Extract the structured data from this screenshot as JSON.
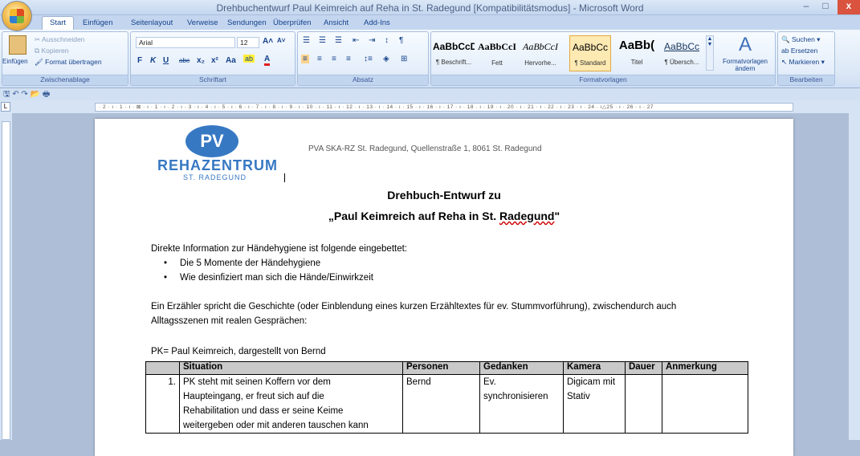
{
  "window": {
    "title": "Drehbuchentwurf Paul Keimreich auf Reha in St. Radegund [Kompatibilitätsmodus] - Microsoft Word",
    "close": "x"
  },
  "tabs": [
    "Start",
    "Einfügen",
    "Seitenlayout",
    "Verweise",
    "Sendungen",
    "Überprüfen",
    "Ansicht",
    "Add-Ins"
  ],
  "clipboard": {
    "paste": "Einfügen",
    "cut": "Ausschneiden",
    "copy": "Kopieren",
    "format_painter": "Format übertragen",
    "label": "Zwischenablage"
  },
  "font": {
    "family": "Arial",
    "size": "12",
    "bold": "F",
    "italic": "K",
    "underline": "U",
    "strike": "abe",
    "sub": "x₂",
    "sup": "x²",
    "case": "Aa",
    "label": "Schriftart"
  },
  "paragraph": {
    "label": "Absatz"
  },
  "styles": {
    "items": [
      {
        "preview": "AaBbCcD",
        "name": "¶ Beschrift..."
      },
      {
        "preview": "AaBbCcI",
        "name": "Fett"
      },
      {
        "preview": "AaBbCcI",
        "name": "Hervorhe..."
      },
      {
        "preview": "AaBbCc",
        "name": "¶ Standard"
      },
      {
        "preview": "AaBb(",
        "name": "Titel"
      },
      {
        "preview": "AaBbCc",
        "name": "¶ Übersch..."
      }
    ],
    "change": "Formatvorlagen ändern",
    "label": "Formatvorlagen"
  },
  "editing": {
    "find": "Suchen",
    "replace": "Ersetzen",
    "select": "Markieren",
    "label": "Bearbeiten"
  },
  "ruler": "· 2 · ı · 1 · ı · ⊠ · ı · 1 · ı · 2 · ı · 3 · ı · 4 · ı · 5 · ı · 6 · ı · 7 · ı · 8 · ı · 9 · ı · 10 · ı · 11 · ı · 12 · ı · 13 · ı · 14 · ı · 15 · ı · 16 · ı · 17 · ı · 18 · ı · 19 · ı · 20 · ı · 21 · ı · 22 · ı · 23 · ı · 24 · ı△25 · ı · 26 · ı · 27",
  "document": {
    "logo": {
      "mark": "PV",
      "main": "REHAZENTRUM",
      "sub": "ST. RADEGUND"
    },
    "address": "PVA SKA-RZ St. Radegund, Quellenstraße 1, 8061 St. Radegund",
    "title1": "Drehbuch-Entwurf zu",
    "title2_pre": "„Paul Keimreich auf Reha in St. ",
    "title2_ul": "Radegund",
    "title2_post": "\"",
    "intro": "Direkte Information zur Händehygiene ist folgende eingebettet:",
    "bullets": [
      "Die 5 Momente der Händehygiene",
      "Wie desinfiziert man sich die Hände/Einwirkzeit"
    ],
    "para2_line1": "Ein Erzähler spricht die Geschichte (oder Einblendung eines kurzen Erzähltextes für ev. Stummvorführung), zwischendurch auch",
    "para2_line2": "Alltagsszenen mit realen Gesprächen:",
    "pk": "PK= Paul Keimreich, dargestellt von Bernd",
    "table": {
      "headers": [
        "",
        "Situation",
        "Personen",
        "Gedanken",
        "Kamera",
        "Dauer",
        "Anmerkung"
      ],
      "rows": [
        {
          "nr": "1.",
          "situation": [
            "PK steht mit seinen Koffern vor dem",
            "Haupteingang, er freut sich auf die",
            "Rehabilitation und dass er seine Keime",
            "weitergeben oder mit anderen tauschen kann"
          ],
          "personen": "Bernd",
          "gedanken": [
            "Ev.",
            "synchronisieren"
          ],
          "kamera": [
            "Digicam mit",
            "Stativ"
          ],
          "dauer": "",
          "anmerkung": ""
        }
      ]
    }
  }
}
